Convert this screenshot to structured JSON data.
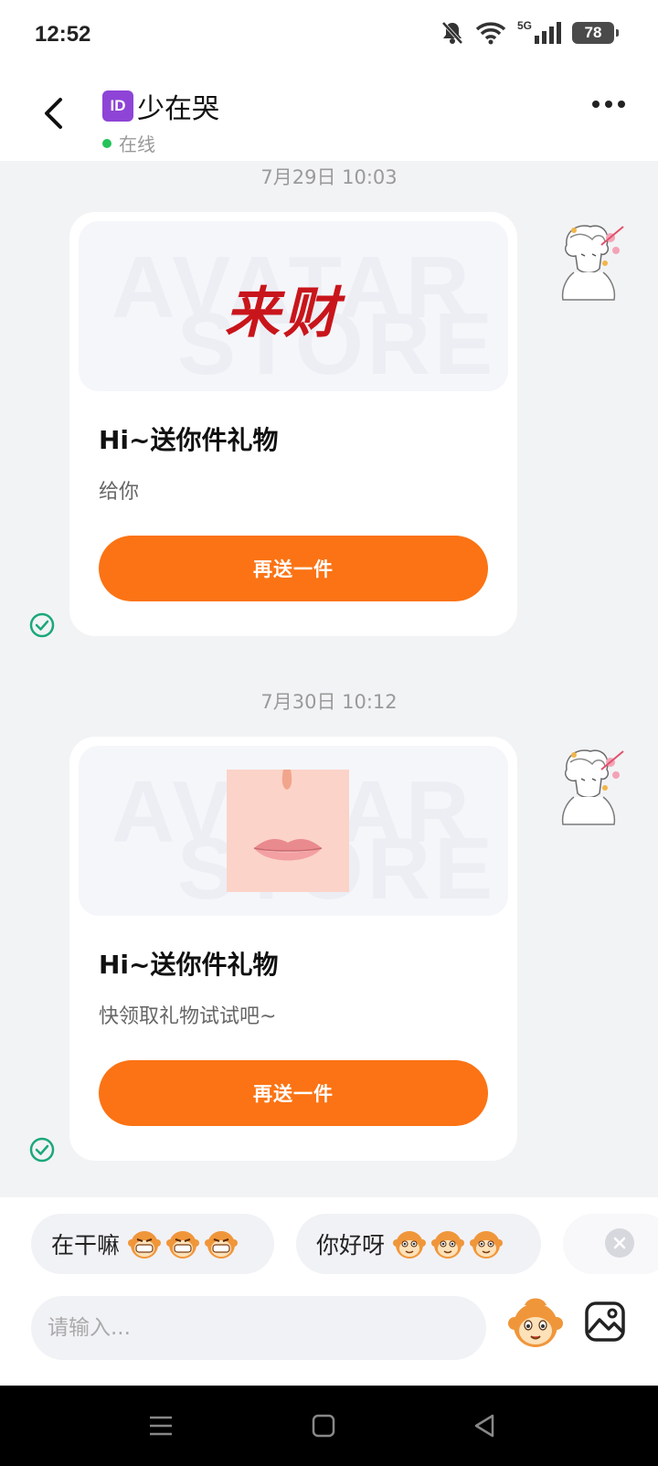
{
  "status_bar": {
    "time": "12:52",
    "network_label": "5G",
    "battery": "78",
    "icons": [
      "bell-muted-icon",
      "wifi-icon",
      "signal-icon",
      "battery-icon"
    ]
  },
  "header": {
    "back_icon": "chevron-left-icon",
    "id_badge": "ID",
    "title": "少在哭",
    "status": "在线",
    "status_color": "#25c25a",
    "more_icon": "more-dots-icon"
  },
  "messages": [
    {
      "timestamp": "7月29日 10:03",
      "banner_watermark": [
        "AVATAR",
        "STORE"
      ],
      "banner_art_text": "来财",
      "title": "Hi~送你件礼物",
      "subtitle": "给你",
      "button": "再送一件"
    },
    {
      "timestamp": "7月30日 10:12",
      "banner_watermark": [
        "AVATAR",
        "STORE"
      ],
      "title": "Hi~送你件礼物",
      "subtitle": "快领取礼物试试吧~",
      "button": "再送一件"
    }
  ],
  "quick_replies": [
    {
      "text": "在干嘛",
      "emoji_count": 3
    },
    {
      "text": "你好呀",
      "emoji_count": 3
    }
  ],
  "input": {
    "placeholder": "请输入...",
    "value": ""
  },
  "colors": {
    "accent": "#fb7314",
    "background": "#f2f3f5",
    "read_check": "#1aa878"
  },
  "nav_icons": [
    "menu-icon",
    "home-icon",
    "back-triangle-icon"
  ]
}
